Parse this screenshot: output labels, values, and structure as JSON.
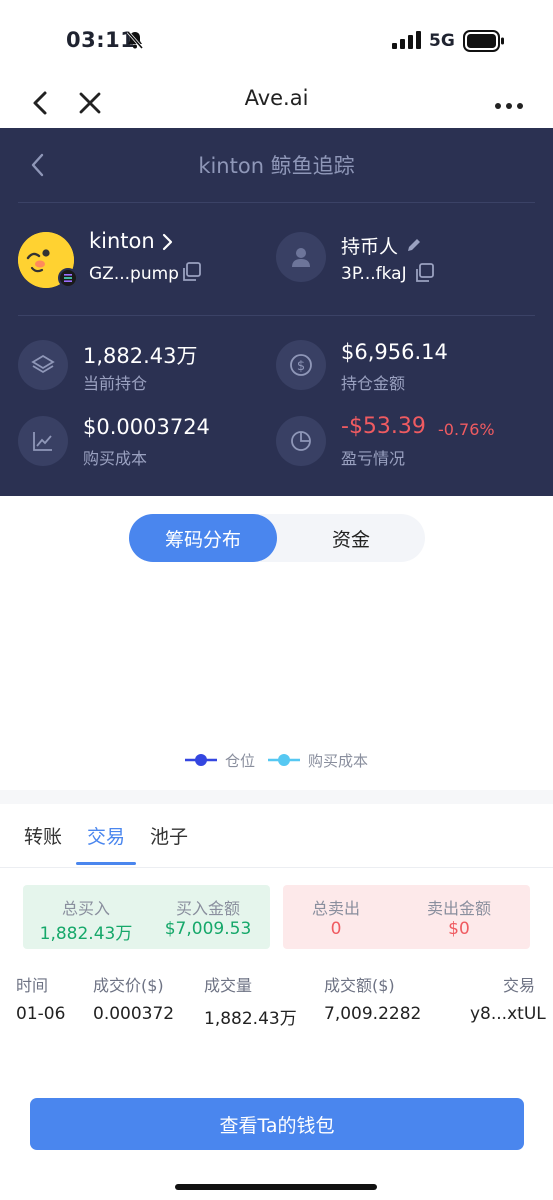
{
  "status_bar": {
    "time": "03:11",
    "network": "5G"
  },
  "nav": {
    "title": "Ave.ai"
  },
  "tracker": {
    "title": "kinton 鲸鱼追踪",
    "token": {
      "name": "kinton",
      "address": "GZ...pump"
    },
    "holder": {
      "label": "持币人",
      "address": "3P...fkaJ"
    },
    "stats": {
      "holding": {
        "value": "1,882.43万",
        "label": "当前持仓"
      },
      "holding_value": {
        "value": "$6,956.14",
        "label": "持仓金额"
      },
      "buy_cost": {
        "value": "$0.0003724",
        "label": "购买成本"
      },
      "pnl": {
        "value": "-$53.39",
        "percent": "-0.76%",
        "label": "盈亏情况"
      }
    }
  },
  "segment": {
    "active": "筹码分布",
    "inactive": "资金"
  },
  "legend": {
    "position": "仓位",
    "buy_cost": "购买成本"
  },
  "tabs": [
    "转账",
    "交易",
    "池子"
  ],
  "summary": {
    "total_buy_label": "总买入",
    "total_buy_value": "1,882.43万",
    "buy_amount_label": "买入金额",
    "buy_amount_value": "$7,009.53",
    "total_sell_label": "总卖出",
    "total_sell_value": "0",
    "sell_amount_label": "卖出金额",
    "sell_amount_value": "$0"
  },
  "table": {
    "headers": [
      "时间",
      "成交价($)",
      "成交量",
      "成交额($)",
      "交易"
    ],
    "rows": [
      {
        "time": "01-06",
        "price": "0.000372",
        "volume": "1,882.43万",
        "amount": "7,009.2282",
        "tx": "y8...xtUL"
      }
    ]
  },
  "cta": {
    "label": "查看Ta的钱包"
  },
  "colors": {
    "accent": "#4a86ee",
    "panel": "#2b3152",
    "green": "#16a86a",
    "red": "#ef5b61"
  }
}
